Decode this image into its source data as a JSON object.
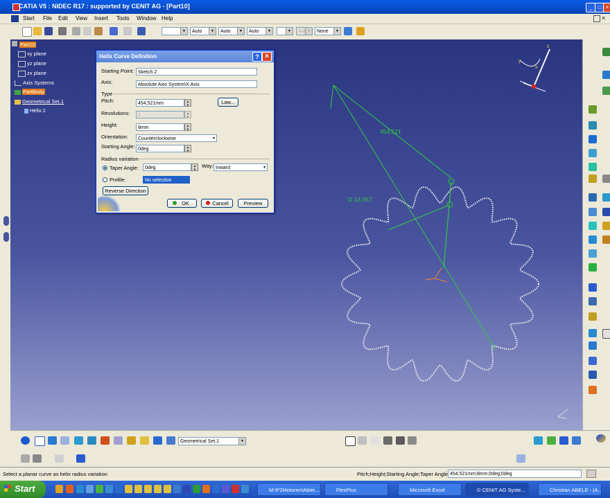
{
  "window": {
    "title": "CATIA V5 : NIDEC R17 : supported by CENIT AG - [Part10]"
  },
  "menu": {
    "items": [
      "Start",
      "File",
      "Edit",
      "View",
      "Insert",
      "Tools",
      "Window",
      "Help"
    ]
  },
  "toolbar": {
    "combos": [
      "",
      "Auto",
      "Auto",
      "Auto",
      "",
      "Aut",
      "None"
    ]
  },
  "tree": {
    "root": "Part10",
    "items": [
      "xy plane",
      "yz plane",
      "zx plane",
      "Axis Systems",
      "PartBody",
      "Geometrical Set.1",
      "Helix.1"
    ]
  },
  "dialog": {
    "title": "Helix Curve Definition",
    "help_icon": "?",
    "close_icon": "×",
    "starting_point_label": "Starting Point:",
    "starting_point_value": "Sketch.2",
    "axis_label": "Axis:",
    "axis_value": "Absolute Axis System\\X Axis",
    "type_group": "Type",
    "pitch_label": "Pitch:",
    "pitch_value": "454,521mm",
    "law_button": "Law...",
    "revolutions_label": "Revolutions:",
    "revolutions_value": "1",
    "height_label": "Height:",
    "height_value": "8mm",
    "orientation_label": "Orientation:",
    "orientation_value": "Counterclockwise",
    "starting_angle_label": "Starting Angle:",
    "starting_angle_value": "0deg",
    "radius_group": "Radius variation",
    "taper_label": "Taper Angle:",
    "taper_value": "0deg",
    "way_label": "Way:",
    "way_value": "Inward",
    "profile_label": "Profile:",
    "profile_value": "No selection",
    "reverse_button": "Reverse Direction",
    "ok_button": "OK",
    "cancel_button": "Cancel",
    "preview_button": "Preview"
  },
  "viewport": {
    "pitch_annotation": "454,521",
    "diameter_annotation": "D 13,357"
  },
  "bottom": {
    "geom_set_combo": "Geometrical Set.1"
  },
  "status": {
    "message": "Select a planar curve as helix radius variation",
    "params_label": "Pitch;Height;Starting Angle;Taper Angle",
    "params_value": "454,521mm;8mm;0deg;0deg"
  },
  "taskbar": {
    "start": "Start",
    "tasks": [
      "M:\\P2Motoren\\Abtei...",
      "FlexPlus",
      "Microsoft Excel",
      "© CENIT AG Syste...",
      "Christian ABELE - (A..."
    ]
  },
  "colors": {
    "selection_orange": "#e07b1a",
    "xp_blue": "#0842b5",
    "green_annotation": "#2ecc40"
  }
}
